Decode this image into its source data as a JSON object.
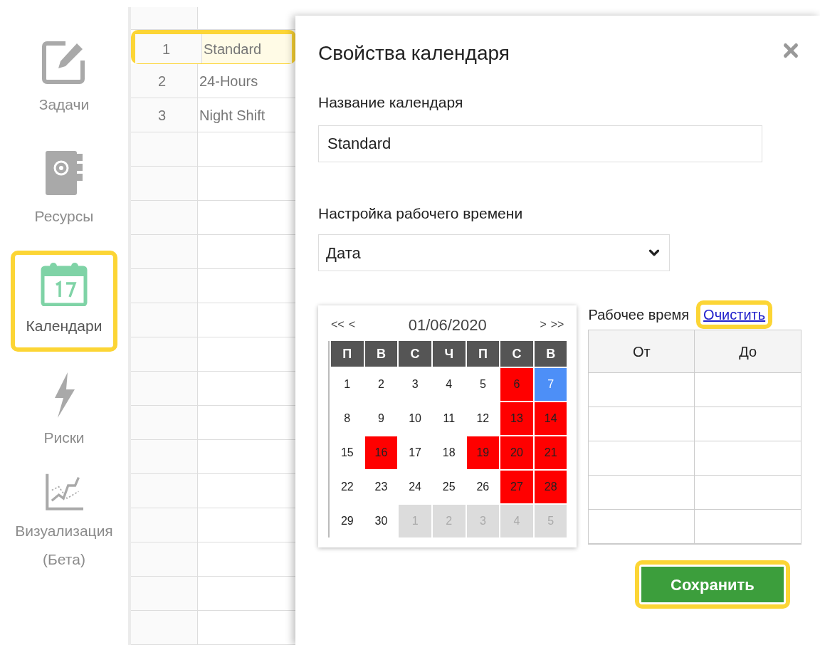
{
  "sidebar": {
    "items": [
      {
        "kind": "tasks",
        "label": "Задачи",
        "selected": false,
        "highlighted": false
      },
      {
        "kind": "resources",
        "label": "Ресурсы",
        "selected": false,
        "highlighted": false
      },
      {
        "kind": "calendars",
        "label": "Календари",
        "selected": true,
        "highlighted": true
      },
      {
        "kind": "risks",
        "label": "Риски",
        "selected": false,
        "highlighted": false
      },
      {
        "kind": "visualization",
        "label": "Визуализация (Бета)",
        "selected": false,
        "highlighted": false
      }
    ]
  },
  "calendar_list": {
    "rows": [
      {
        "number": "1",
        "name": "Standard",
        "selected": true,
        "highlighted": true
      },
      {
        "number": "2",
        "name": "24-Hours",
        "selected": false,
        "highlighted": false
      },
      {
        "number": "3",
        "name": "Night Shift",
        "selected": false,
        "highlighted": false
      }
    ]
  },
  "dialog": {
    "title": "Свойства календаря",
    "name_field": {
      "label": "Название календаря",
      "value": "Standard"
    },
    "worktime_select": {
      "label": "Настройка рабочего времени",
      "value": "Дата"
    },
    "date_picker": {
      "nav_prev": [
        "<<",
        "<"
      ],
      "month": "01/06/2020",
      "nav_next": [
        ">",
        ">>"
      ],
      "weekdays": [
        "П",
        "В",
        "С",
        "Ч",
        "П",
        "С",
        "В"
      ],
      "days": [
        {
          "label": "1",
          "kind": "workday",
          "selected": false
        },
        {
          "label": "2",
          "kind": "workday",
          "selected": false
        },
        {
          "label": "3",
          "kind": "workday",
          "selected": false
        },
        {
          "label": "4",
          "kind": "workday",
          "selected": false
        },
        {
          "label": "5",
          "kind": "workday",
          "selected": false
        },
        {
          "label": "6",
          "kind": "holiday",
          "selected": false
        },
        {
          "label": "7",
          "kind": "holiday",
          "selected": true
        },
        {
          "label": "8",
          "kind": "workday",
          "selected": false
        },
        {
          "label": "9",
          "kind": "workday",
          "selected": false
        },
        {
          "label": "10",
          "kind": "workday",
          "selected": false
        },
        {
          "label": "11",
          "kind": "workday",
          "selected": false
        },
        {
          "label": "12",
          "kind": "workday",
          "selected": false
        },
        {
          "label": "13",
          "kind": "holiday",
          "selected": false
        },
        {
          "label": "14",
          "kind": "holiday",
          "selected": false
        },
        {
          "label": "15",
          "kind": "workday",
          "selected": false
        },
        {
          "label": "16",
          "kind": "holiday",
          "selected": false
        },
        {
          "label": "17",
          "kind": "workday",
          "selected": false
        },
        {
          "label": "18",
          "kind": "workday",
          "selected": false
        },
        {
          "label": "19",
          "kind": "holiday",
          "selected": false
        },
        {
          "label": "20",
          "kind": "holiday",
          "selected": false
        },
        {
          "label": "21",
          "kind": "holiday",
          "selected": false
        },
        {
          "label": "22",
          "kind": "workday",
          "selected": false
        },
        {
          "label": "23",
          "kind": "workday",
          "selected": false
        },
        {
          "label": "24",
          "kind": "workday",
          "selected": false
        },
        {
          "label": "25",
          "kind": "workday",
          "selected": false
        },
        {
          "label": "26",
          "kind": "workday",
          "selected": false
        },
        {
          "label": "27",
          "kind": "holiday",
          "selected": false
        },
        {
          "label": "28",
          "kind": "holiday",
          "selected": false
        },
        {
          "label": "29",
          "kind": "workday",
          "selected": false
        },
        {
          "label": "30",
          "kind": "workday",
          "selected": false
        },
        {
          "label": "1",
          "kind": "outside",
          "selected": false
        },
        {
          "label": "2",
          "kind": "outside",
          "selected": false
        },
        {
          "label": "3",
          "kind": "outside",
          "selected": false
        },
        {
          "label": "4",
          "kind": "outside",
          "selected": false
        },
        {
          "label": "5",
          "kind": "outside",
          "selected": false
        }
      ]
    },
    "work_hours": {
      "title": "Рабочее время",
      "clear_link": {
        "label": "Очистить",
        "highlighted": true
      },
      "columns": [
        "От",
        "До"
      ]
    },
    "save_button": {
      "label": "Сохранить",
      "highlighted": true
    }
  }
}
